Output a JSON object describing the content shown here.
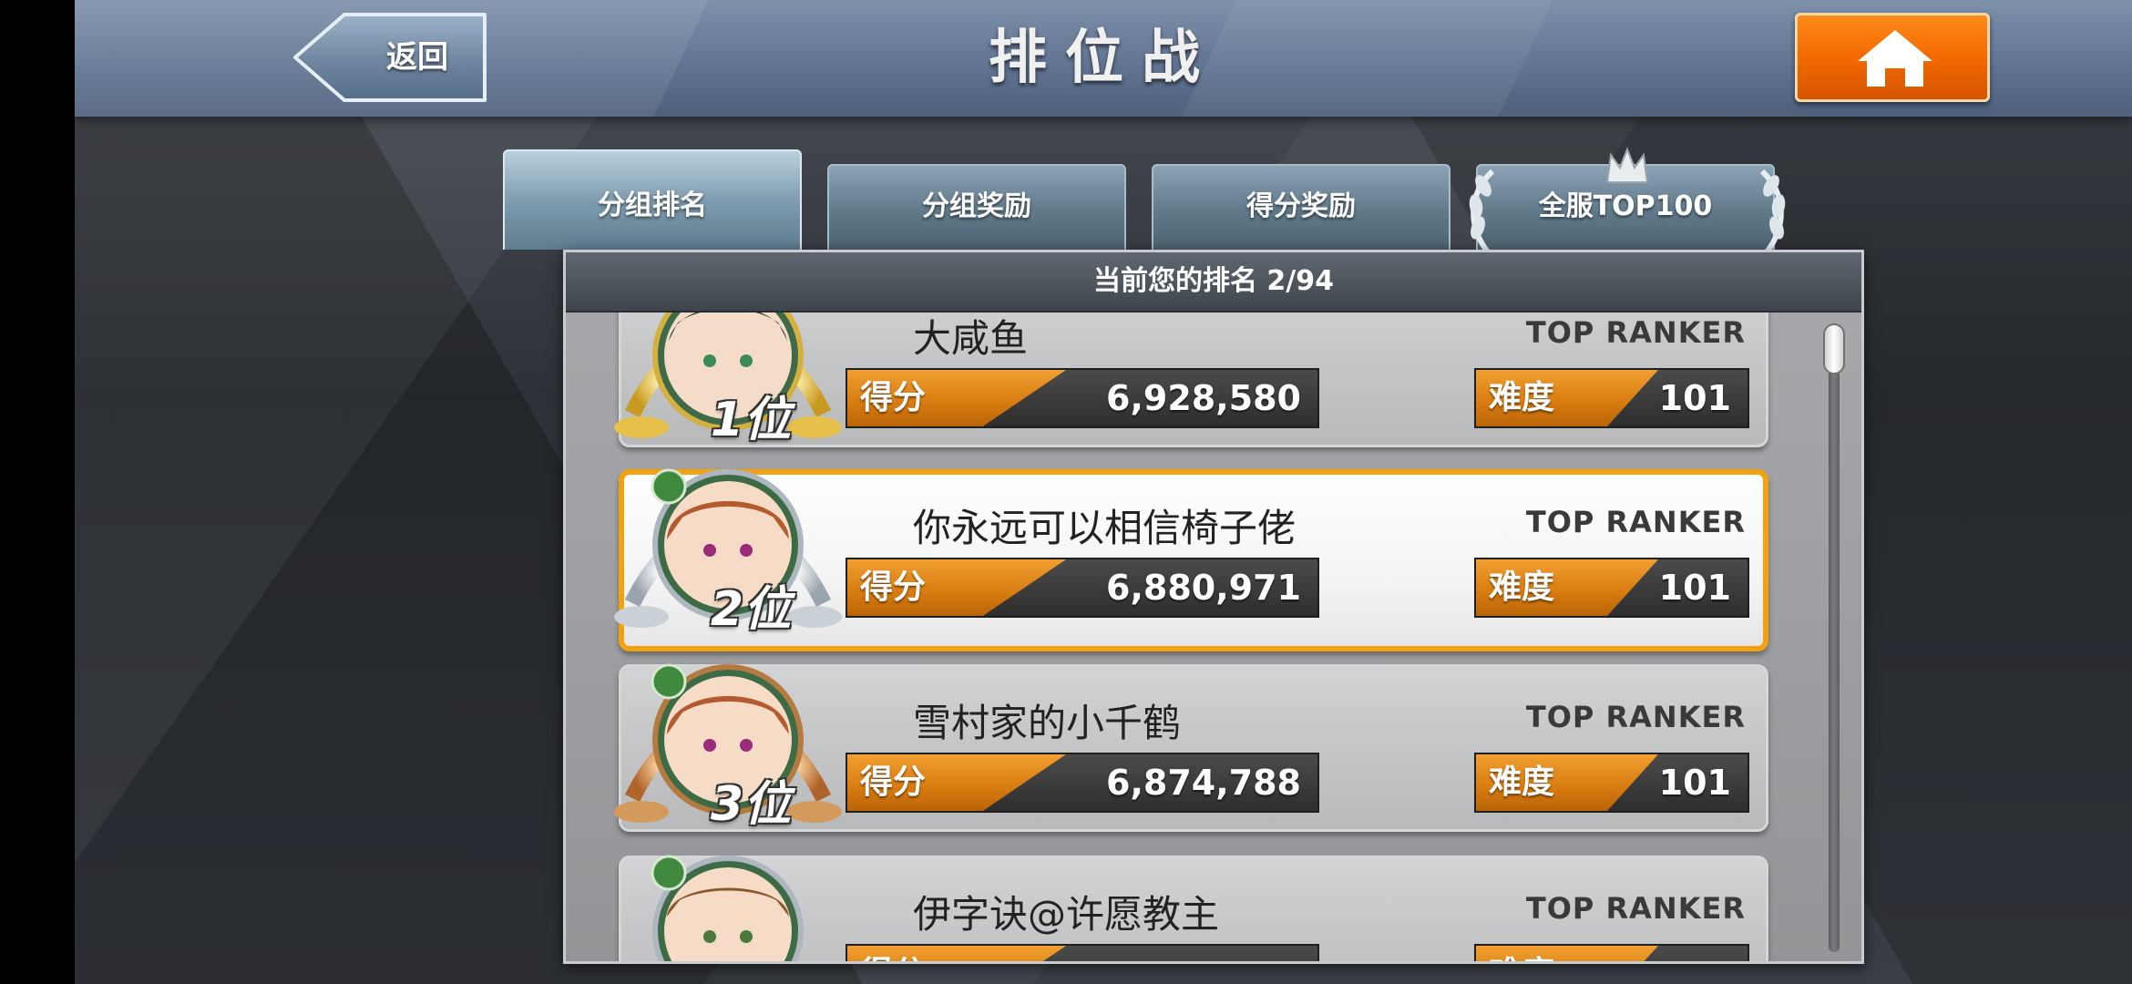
{
  "header": {
    "back_label": "返回",
    "title": "排位战",
    "home_icon": "home-icon"
  },
  "tabs": [
    {
      "label": "分组排名",
      "active": true
    },
    {
      "label": "分组奖励",
      "active": false
    },
    {
      "label": "得分奖励",
      "active": false
    },
    {
      "label": "全服TOP100",
      "active": false,
      "decoration": "laurel-crown"
    }
  ],
  "rank_banner": {
    "text": "当前您的排名 2/94"
  },
  "rows": [
    {
      "rank_label": "1位",
      "name": "大咸鱼",
      "tag": "TOP RANKER",
      "score_label": "得分",
      "score": "6,928,580",
      "difficulty_label": "难度",
      "difficulty": "101",
      "wreath": "gold"
    },
    {
      "rank_label": "2位",
      "name": "你永远可以相信椅子佬",
      "tag": "TOP RANKER",
      "score_label": "得分",
      "score": "6,880,971",
      "difficulty_label": "难度",
      "difficulty": "101",
      "wreath": "silver",
      "is_current_user": true
    },
    {
      "rank_label": "3位",
      "name": "雪村家的小千鹤",
      "tag": "TOP RANKER",
      "score_label": "得分",
      "score": "6,874,788",
      "difficulty_label": "难度",
      "difficulty": "101",
      "wreath": "bronze"
    },
    {
      "rank_label": "",
      "name": "伊字诀@许愿教主",
      "tag": "TOP RANKER",
      "score_label": "得分",
      "score": "",
      "difficulty_label": "难度",
      "difficulty": "",
      "wreath": "silver"
    }
  ],
  "colors": {
    "accent_orange": "#f2a10f",
    "home_button": "#f26a00",
    "header_blue": "#5f7290"
  }
}
